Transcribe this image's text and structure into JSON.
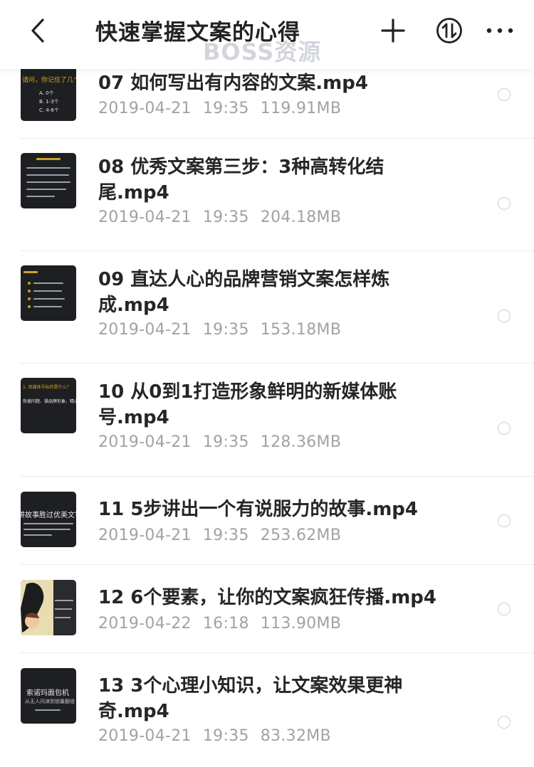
{
  "header": {
    "title": "快速掌握文案的心得",
    "watermark": "BOSS资源"
  },
  "files": [
    {
      "name": "07 如何写出有内容的文案.mp4",
      "date": "2019-04-21",
      "time": "19:35",
      "size": "119.91MB"
    },
    {
      "name": "08 优秀文案第三步：3种高转化结尾.mp4",
      "date": "2019-04-21",
      "time": "19:35",
      "size": "204.18MB"
    },
    {
      "name": "09 直达人心的品牌营销文案怎样炼成.mp4",
      "date": "2019-04-21",
      "time": "19:35",
      "size": "153.18MB"
    },
    {
      "name": "10 从0到1打造形象鲜明的新媒体账号.mp4",
      "date": "2019-04-21",
      "time": "19:35",
      "size": "128.36MB"
    },
    {
      "name": "11 5步讲出一个有说服力的故事.mp4",
      "date": "2019-04-21",
      "time": "19:35",
      "size": "253.62MB"
    },
    {
      "name": "12 6个要素，让你的文案疯狂传播.mp4",
      "date": "2019-04-22",
      "time": "16:18",
      "size": "113.90MB"
    },
    {
      "name": "13 3个心理小知识，让文案效果更神奇.mp4",
      "date": "2019-04-21",
      "time": "19:35",
      "size": "83.32MB"
    }
  ],
  "thumbnails": {
    "t07": {
      "text1": "请问，你记住了几个",
      "text2": "A. 0个",
      "text3": "B. 1-3个",
      "text4": "C. 4-6个"
    },
    "t10": {
      "text1": "1. 用媒体号标的是什么？",
      "text2": "热搜问题、操品牌形象、精心设"
    },
    "t11": {
      "text1": "讲故事胜过优美文字"
    },
    "t13": {
      "text1": "索诺玛面包机",
      "text2": "从无人问津到销量翻倍"
    }
  },
  "colors": {
    "title": "#222222",
    "filename": "#262626",
    "meta": "#a2a2a2",
    "watermark": "#d2d6dc"
  }
}
